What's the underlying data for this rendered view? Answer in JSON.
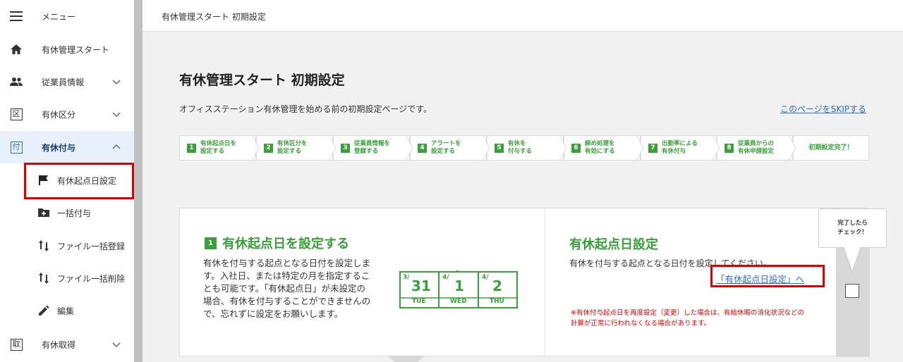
{
  "sidebar": {
    "menu_label": "メニュー",
    "items": [
      {
        "label": "有休管理スタート",
        "icon": "home-icon"
      },
      {
        "label": "従業員情報",
        "icon": "people-icon"
      },
      {
        "label": "有休区分",
        "icon": "ku-box-icon",
        "icon_char": "区"
      },
      {
        "label": "有休付与",
        "icon": "fu-box-icon",
        "icon_char": "付",
        "active": true
      },
      {
        "label": "有休取得",
        "icon": "tori-box-icon",
        "icon_char": "取"
      }
    ],
    "subitems": [
      {
        "label": "有休起点日設定",
        "icon": "flag-icon",
        "highlighted": true
      },
      {
        "label": "一括付与",
        "icon": "folder-plus-icon"
      },
      {
        "label": "ファイル一括登録",
        "icon": "sort-arrows-icon"
      },
      {
        "label": "ファイル一括削除",
        "icon": "sort-arrows-icon"
      },
      {
        "label": "編集",
        "icon": "pencil-icon"
      }
    ]
  },
  "topbar": {
    "title": "有休管理スタート 初期設定"
  },
  "main": {
    "page_title": "有休管理スタート 初期設定",
    "description": "オフィスステーション有休管理を始める前の初期設定ページです。",
    "skip_link": "このページをSKIPする",
    "steps": [
      {
        "num": "1",
        "line1": "有休起点日を",
        "line2": "設定する"
      },
      {
        "num": "2",
        "line1": "有休区分を",
        "line2": "設定する"
      },
      {
        "num": "3",
        "line1": "従業員情報を",
        "line2": "登録する"
      },
      {
        "num": "4",
        "line1": "アラートを",
        "line2": "設定する"
      },
      {
        "num": "5",
        "line1": "有休を",
        "line2": "付与する"
      },
      {
        "num": "6",
        "line1": "締め処理を",
        "line2": "有効にする"
      },
      {
        "num": "7",
        "line1": "出勤率による",
        "line2": "有休付与"
      },
      {
        "num": "8",
        "line1": "従業員からの",
        "line2": "有休申請設定"
      },
      {
        "num": "",
        "line1": "初期設定完了！",
        "line2": ""
      }
    ],
    "card": {
      "step_num": "1",
      "title": "有休起点日を設定する",
      "body": "有休を付与する起点となる日付を設定します。入社日、または特定の月を指定することも可能です。「有休起点日」が未設定の場合、有休を付与することができませんので、忘れずに設定をお願いします。",
      "calendar": [
        {
          "month": "3/",
          "day": "31",
          "weekday": "TUE"
        },
        {
          "month": "4/",
          "day": "1",
          "weekday": "WED"
        },
        {
          "month": "4/",
          "day": "2",
          "weekday": "THU"
        }
      ],
      "right_title": "有休起点日設定",
      "right_desc": "有休を付与する起点となる日付を設定してください。",
      "right_link": "「有休起点日設定」へ",
      "note": "※有休付与起点日を再度設定（変更）した場合は、有給休暇の消化状況などの計算が正常に行われなくなる場合があります。",
      "bubble_line1": "完了したら",
      "bubble_line2": "チェック！"
    }
  },
  "colors": {
    "accent_green": "#3aa03a",
    "link_blue": "#2a6fc9",
    "highlight_red": "#e00000",
    "active_bg": "#e7f0fb"
  }
}
